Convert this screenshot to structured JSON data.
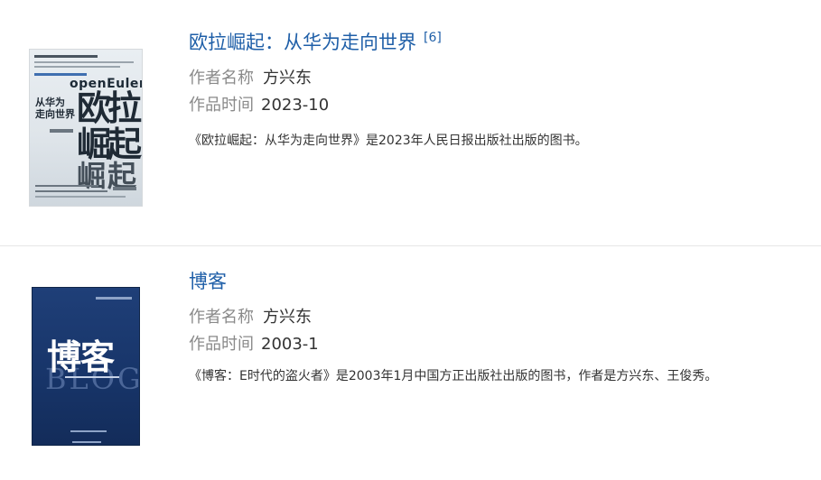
{
  "books": [
    {
      "title": "欧拉崛起：从华为走向世界",
      "ref": "[6]",
      "author_label": "作者名称",
      "author": "方兴东",
      "time_label": "作品时间",
      "time": "2023-10",
      "description": "《欧拉崛起：从华为走向世界》是2023年人民日报出版社出版的图书。",
      "cover": {
        "brand": "openEuler",
        "big_chars": [
          "欧",
          "拉",
          "崛",
          "起",
          "崛",
          "起"
        ],
        "subtitle_line1": "从华为",
        "subtitle_line2": "走向世界"
      }
    },
    {
      "title": "博客",
      "author_label": "作者名称",
      "author": "方兴东",
      "time_label": "作品时间",
      "time": "2003-1",
      "description": "《博客：E时代的盗火者》是2003年1月中国方正出版社出版的图书，作者是方兴东、王俊秀。",
      "cover": {
        "big_text": "博客",
        "watermark": "BLOG"
      }
    }
  ],
  "colors": {
    "link": "#1f5fa8",
    "label": "#8a8a8a",
    "text": "#333333",
    "divider": "#e6e6e6",
    "cover2_bg": "#1a386e"
  }
}
